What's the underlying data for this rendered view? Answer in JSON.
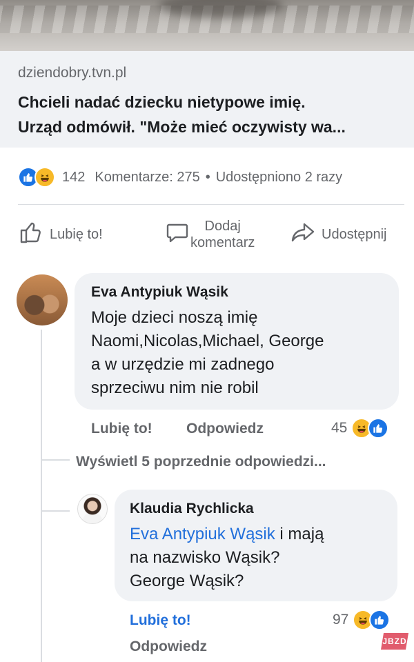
{
  "link_preview": {
    "domain": "dziendobry.tvn.pl",
    "title_line1": "Chcieli nadać dziecku nietypowe imię.",
    "title_line2": "Urząd odmówił. \"Może mieć oczywisty wa..."
  },
  "stats": {
    "reaction_count": "142",
    "comments": "Komentarze: 275",
    "separator": "•",
    "shares": "Udostępniono 2 razy"
  },
  "actions": {
    "like": "Lubię to!",
    "comment_line1": "Dodaj",
    "comment_line2": "komentarz",
    "share": "Udostępnij"
  },
  "comments": [
    {
      "author": "Eva Antypiuk Wąsik",
      "lines": [
        "Moje dzieci noszą imię",
        "Naomi,Nicolas,Michael, George",
        "a w urzędzie mi zadnego",
        "sprzeciwu nim nie robil"
      ],
      "like_label": "Lubię to!",
      "reply_label": "Odpowiedz",
      "reaction_count": "45"
    }
  ],
  "view_previous_replies": "Wyświetl 5 poprzednie odpowiedzi...",
  "reply": {
    "author": "Klaudia Rychlicka",
    "mention": "Eva Antypiuk Wąsik",
    "line1_rest": " i mają",
    "line2": "na nazwisko Wąsik?",
    "line3": "George Wąsik?",
    "like_label": "Lubię to!",
    "reply_label": "Odpowiedz",
    "reaction_count": "97"
  },
  "watermark": "JBZD",
  "colors": {
    "accent_blue": "#1b74e4",
    "mention_blue": "#216fdb",
    "haha_yellow": "#f7b928",
    "bubble_gray": "#f0f2f5",
    "muted_text": "#65676b"
  },
  "icons": [
    "like-reaction-icon",
    "haha-reaction-icon",
    "thumbs-up-icon",
    "comment-bubble-icon",
    "share-arrow-icon"
  ]
}
